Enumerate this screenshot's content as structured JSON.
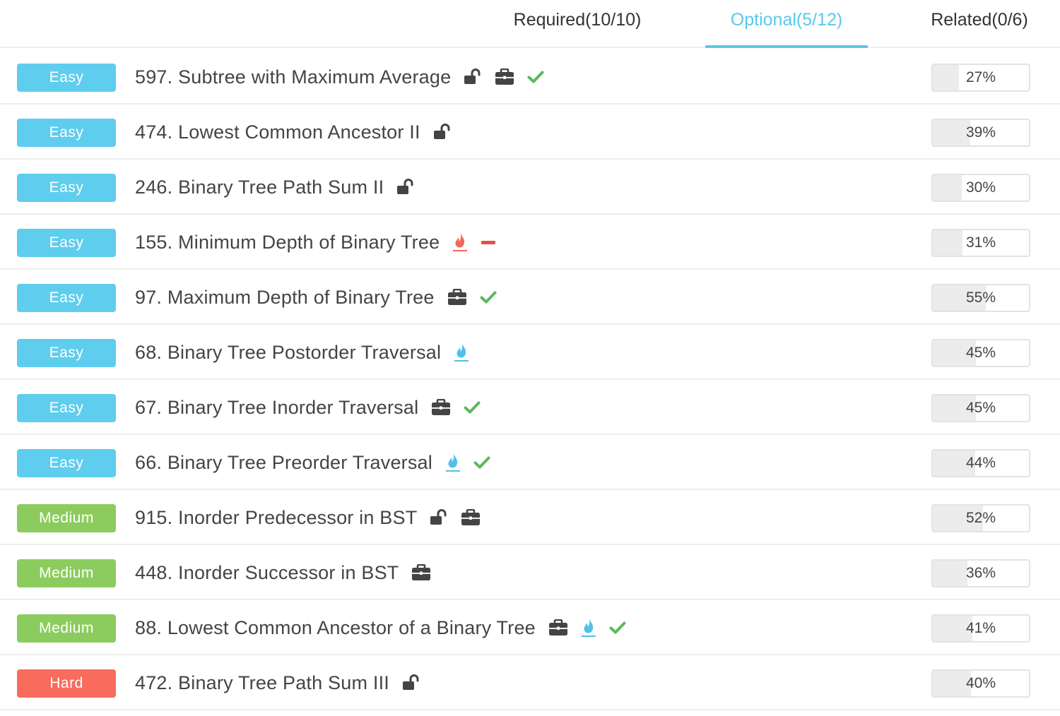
{
  "tabs": [
    {
      "label": "Required(10/10)",
      "active": false
    },
    {
      "label": "Optional(5/12)",
      "active": true
    },
    {
      "label": "Related(0/6)",
      "active": false
    }
  ],
  "colors": {
    "accent": "#5bc8e9",
    "easy": "#5fcdee",
    "medium": "#8ccc5f",
    "hard": "#f86c5d",
    "check": "#5cb85c",
    "dash": "#e0524a",
    "flame_red": "#f06a5a",
    "flame_blue": "#4fc0e8"
  },
  "problems": [
    {
      "level": "Easy",
      "title": "597. Subtree with Maximum Average",
      "icons": [
        "lock-open-icon",
        "briefcase-icon",
        "check-icon"
      ],
      "rate": "27%",
      "rate_value": 27
    },
    {
      "level": "Easy",
      "title": "474. Lowest Common Ancestor II",
      "icons": [
        "lock-open-icon"
      ],
      "rate": "39%",
      "rate_value": 39
    },
    {
      "level": "Easy",
      "title": "246. Binary Tree Path Sum II",
      "icons": [
        "lock-open-icon"
      ],
      "rate": "30%",
      "rate_value": 30
    },
    {
      "level": "Easy",
      "title": "155. Minimum Depth of Binary Tree",
      "icons": [
        "flame-red-icon",
        "minus-icon"
      ],
      "rate": "31%",
      "rate_value": 31
    },
    {
      "level": "Easy",
      "title": "97. Maximum Depth of Binary Tree",
      "icons": [
        "briefcase-icon",
        "check-icon"
      ],
      "rate": "55%",
      "rate_value": 55
    },
    {
      "level": "Easy",
      "title": "68. Binary Tree Postorder Traversal",
      "icons": [
        "flame-blue-icon"
      ],
      "rate": "45%",
      "rate_value": 45
    },
    {
      "level": "Easy",
      "title": "67. Binary Tree Inorder Traversal",
      "icons": [
        "briefcase-icon",
        "check-icon"
      ],
      "rate": "45%",
      "rate_value": 45
    },
    {
      "level": "Easy",
      "title": "66. Binary Tree Preorder Traversal",
      "icons": [
        "flame-blue-icon",
        "check-icon"
      ],
      "rate": "44%",
      "rate_value": 44
    },
    {
      "level": "Medium",
      "title": "915. Inorder Predecessor in BST",
      "icons": [
        "lock-open-icon",
        "briefcase-icon"
      ],
      "rate": "52%",
      "rate_value": 52
    },
    {
      "level": "Medium",
      "title": "448. Inorder Successor in BST",
      "icons": [
        "briefcase-icon"
      ],
      "rate": "36%",
      "rate_value": 36
    },
    {
      "level": "Medium",
      "title": "88. Lowest Common Ancestor of a Binary Tree",
      "icons": [
        "briefcase-icon",
        "flame-blue-icon",
        "check-icon"
      ],
      "rate": "41%",
      "rate_value": 41
    },
    {
      "level": "Hard",
      "title": "472. Binary Tree Path Sum III",
      "icons": [
        "lock-open-icon"
      ],
      "rate": "40%",
      "rate_value": 40
    }
  ]
}
